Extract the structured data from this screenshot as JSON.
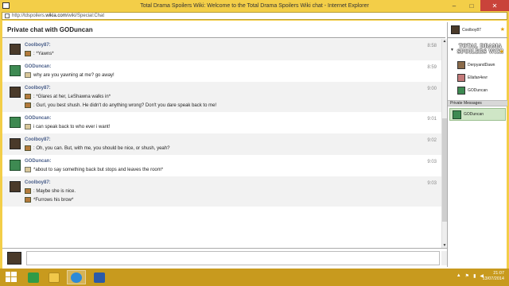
{
  "window": {
    "title": "Total Drama Spoilers Wiki: Welcome to the Total Drama Spoilers Wiki chat - Internet Explorer",
    "controls": {
      "minimize": "–",
      "maximize": "□",
      "close": "✕"
    }
  },
  "address": {
    "prefix": "http://tdspoilers.",
    "domain": "wikia.com",
    "suffix": "/wiki/Special:Chat"
  },
  "chat": {
    "header": "Private chat with GODuncan",
    "messages": [
      {
        "author": "Coolboy87:",
        "time": "8:58",
        "avatar": "cb",
        "lines": [
          {
            "icon": "cb",
            "text": ": *Yawns*"
          }
        ]
      },
      {
        "author": "GODuncan:",
        "time": "8:59",
        "avatar": "gd",
        "lines": [
          {
            "icon": "gd",
            "text": "why are you yawning at me? go away!"
          }
        ]
      },
      {
        "author": "Coolboy87:",
        "time": "9:00",
        "avatar": "cb",
        "lines": [
          {
            "icon": "cb",
            "text": ": *Glares at her, LeShawna walks in*"
          },
          {
            "icon": "cb",
            "text": ": Gurl, you best shush. He didn't do anything wrong? Don't you dare speak back to me!"
          }
        ]
      },
      {
        "author": "GODuncan:",
        "time": "9:01",
        "avatar": "gd",
        "lines": [
          {
            "icon": "gd",
            "text": "i can speak back to who ever i want!"
          }
        ]
      },
      {
        "author": "Coolboy87:",
        "time": "9:02",
        "avatar": "cb",
        "lines": [
          {
            "icon": "cb",
            "text": ": Oh, you can. But, with me, you should be nice, or shush, yeah?"
          }
        ]
      },
      {
        "author": "GODuncan:",
        "time": "9:03",
        "avatar": "gd",
        "lines": [
          {
            "icon": "gd",
            "text": "*about to say something back but stops and leaves the room*"
          }
        ]
      },
      {
        "author": "Coolboy87:",
        "time": "9:03",
        "avatar": "cb",
        "lines": [
          {
            "icon": "cb",
            "text": ": Maybe she is nice."
          },
          {
            "icon": "cb",
            "text": "*Furrows his brow*"
          }
        ]
      }
    ]
  },
  "sidebar": {
    "me": {
      "name": "Coolboy87"
    },
    "wiki_logo": "TOTAL DRAMA SPOILERS WIKI",
    "users": [
      {
        "name": "DerpyandDawn",
        "color": "#8a6a4a"
      },
      {
        "name": "Ellafan4evr",
        "color": "#c47a7a"
      },
      {
        "name": "GODuncan",
        "color": "#3e8a52"
      }
    ],
    "pm_header": "Private Messages",
    "pm_item": {
      "name": "GODuncan"
    }
  },
  "taskbar": {
    "clock_time": "21:07",
    "clock_date": "13/07/2014"
  },
  "colors": {
    "accent": "#f3ce48",
    "taskbar": "#c89a1e",
    "author": "#4a5f8a",
    "pm_highlight": "#cfe6c6"
  }
}
